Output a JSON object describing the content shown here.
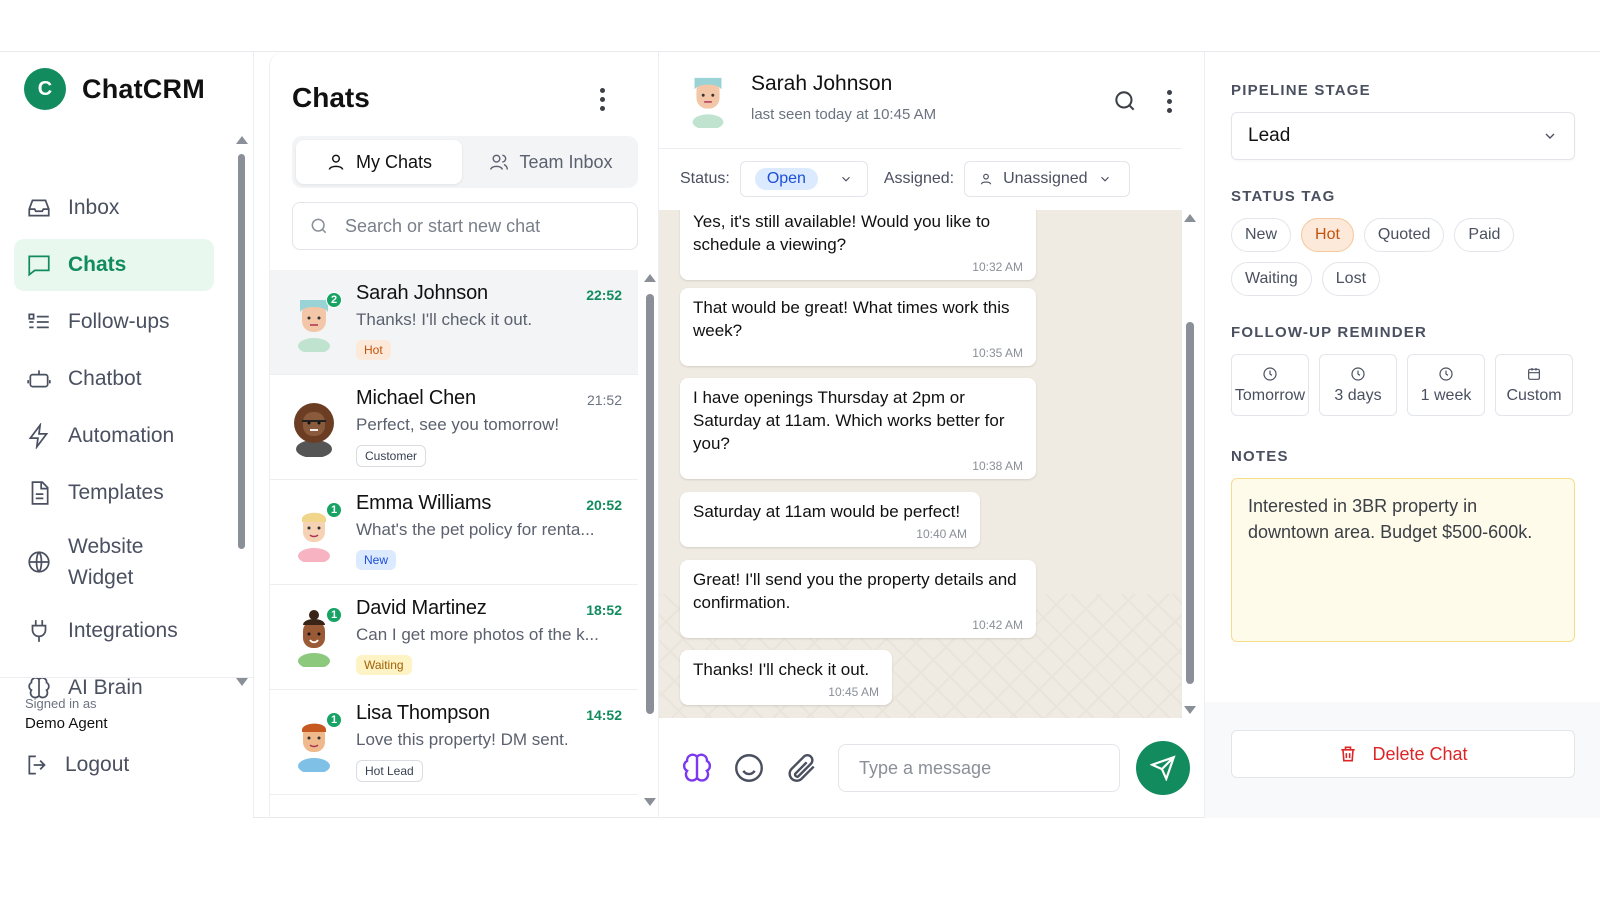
{
  "brand": {
    "logo_letter": "C",
    "name": "ChatCRM",
    "color": "#128c5e"
  },
  "sidebar": {
    "items": [
      {
        "label": "Inbox",
        "icon": "inbox-icon"
      },
      {
        "label": "Chats",
        "icon": "chat-icon",
        "active": true
      },
      {
        "label": "Follow-ups",
        "icon": "list-icon"
      },
      {
        "label": "Chatbot",
        "icon": "bot-icon"
      },
      {
        "label": "Automation",
        "icon": "bolt-icon"
      },
      {
        "label": "Templates",
        "icon": "document-icon"
      },
      {
        "label": "Website Widget",
        "icon": "globe-icon"
      },
      {
        "label": "Integrations",
        "icon": "plug-icon"
      },
      {
        "label": "AI Brain",
        "icon": "brain-icon"
      }
    ],
    "signed_in_label": "Signed in as",
    "user": "Demo Agent",
    "logout": "Logout"
  },
  "chats": {
    "title": "Chats",
    "tabs": [
      {
        "label": "My Chats",
        "active": true
      },
      {
        "label": "Team Inbox"
      }
    ],
    "search_placeholder": "Search or start new chat",
    "list": [
      {
        "name": "Sarah Johnson",
        "time": "22:52",
        "message": "Thanks! I'll check it out.",
        "tag": "Hot",
        "unread": "2"
      },
      {
        "name": "Michael Chen",
        "time": "21:52",
        "message": "Perfect, see you tomorrow!",
        "tag": "Customer",
        "unread": ""
      },
      {
        "name": "Emma Williams",
        "time": "20:52",
        "message": "What's the pet policy for renta...",
        "tag": "New",
        "unread": "1"
      },
      {
        "name": "David Martinez",
        "time": "18:52",
        "message": "Can I get more photos of the k...",
        "tag": "Waiting",
        "unread": "1"
      },
      {
        "name": "Lisa Thompson",
        "time": "14:52",
        "message": "Love this property! DM sent.",
        "tag": "Hot Lead",
        "unread": "1"
      }
    ]
  },
  "conversation": {
    "name": "Sarah Johnson",
    "last_seen": "last seen today at 10:45 AM",
    "status_label": "Status:",
    "status_value": "Open",
    "assigned_label": "Assigned:",
    "assigned_value": "Unassigned",
    "messages": [
      {
        "text": "Yes, it's still available! Would you like to schedule a viewing?",
        "time": "10:32 AM"
      },
      {
        "text": "That would be great! What times work this week?",
        "time": "10:35 AM"
      },
      {
        "text": "I have openings Thursday at 2pm or Saturday at 11am. Which works better for you?",
        "time": "10:38 AM"
      },
      {
        "text": "Saturday at 11am would be perfect!",
        "time": "10:40 AM"
      },
      {
        "text": "Great! I'll send you the property details and confirmation.",
        "time": "10:42 AM"
      },
      {
        "text": "Thanks! I'll check it out.",
        "time": "10:45 AM"
      }
    ],
    "input_placeholder": "Type a message"
  },
  "details": {
    "pipeline_label": "PIPELINE STAGE",
    "pipeline_value": "Lead",
    "status_tag_label": "STATUS TAG",
    "status_tags": [
      "New",
      "Hot",
      "Quoted",
      "Paid",
      "Waiting",
      "Lost"
    ],
    "active_tag": "Hot",
    "reminder_label": "FOLLOW-UP REMINDER",
    "reminders": [
      "Tomorrow",
      "3 days",
      "1 week",
      "Custom"
    ],
    "notes_label": "NOTES",
    "notes": "Interested in 3BR property in downtown area. Budget $500-600k.",
    "delete": "Delete Chat"
  }
}
